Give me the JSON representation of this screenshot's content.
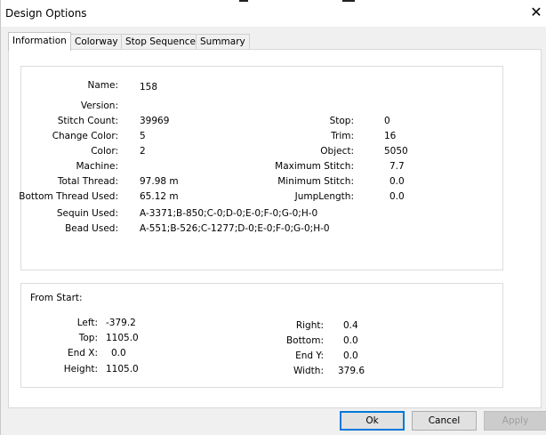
{
  "window": {
    "title": "Design Options"
  },
  "tabs": [
    "Information",
    "Colorway",
    "Stop Sequence",
    "Summary"
  ],
  "info": {
    "left": [
      {
        "label": "Name:",
        "value": "158"
      },
      {
        "label": "Version:",
        "value": ""
      },
      {
        "label": "Stitch Count:",
        "value": "39969"
      },
      {
        "label": "Change Color:",
        "value": "5"
      },
      {
        "label": "Color:",
        "value": "2"
      },
      {
        "label": "Machine:",
        "value": ""
      },
      {
        "label": "Total Thread:",
        "value": "97.98 m"
      },
      {
        "label": "Bottom Thread Used:",
        "value": "65.12 m"
      },
      {
        "label": "Sequin Used:",
        "value": "A-3371;B-850;C-0;D-0;E-0;F-0;G-0;H-0"
      },
      {
        "label": "Bead Used:",
        "value": "A-551;B-526;C-1277;D-0;E-0;F-0;G-0;H-0"
      }
    ],
    "right": [
      {
        "label": "Stop:",
        "value": "0"
      },
      {
        "label": "Trim:",
        "value": "16"
      },
      {
        "label": "Object:",
        "value": "5050"
      },
      {
        "label": "Maximum Stitch:",
        "value": "7.7"
      },
      {
        "label": "Minimum Stitch:",
        "value": "0.0"
      },
      {
        "label": "JumpLength:",
        "value": "0.0"
      }
    ]
  },
  "from_start": {
    "title": "From Start:",
    "left": [
      {
        "label": "Left:",
        "value": "-379.2"
      },
      {
        "label": "Top:",
        "value": "1105.0"
      },
      {
        "label": "End X:",
        "value": "0.0"
      },
      {
        "label": "Height:",
        "value": "1105.0"
      }
    ],
    "right": [
      {
        "label": "Right:",
        "value": "0.4"
      },
      {
        "label": "Bottom:",
        "value": "0.0"
      },
      {
        "label": "End Y:",
        "value": "0.0"
      },
      {
        "label": "Width:",
        "value": "379.6"
      }
    ]
  },
  "buttons": {
    "ok": "Ok",
    "cancel": "Cancel",
    "apply": "Apply"
  },
  "icons": {
    "close": "close-icon"
  },
  "colors": {
    "accent": "#0078d7"
  }
}
